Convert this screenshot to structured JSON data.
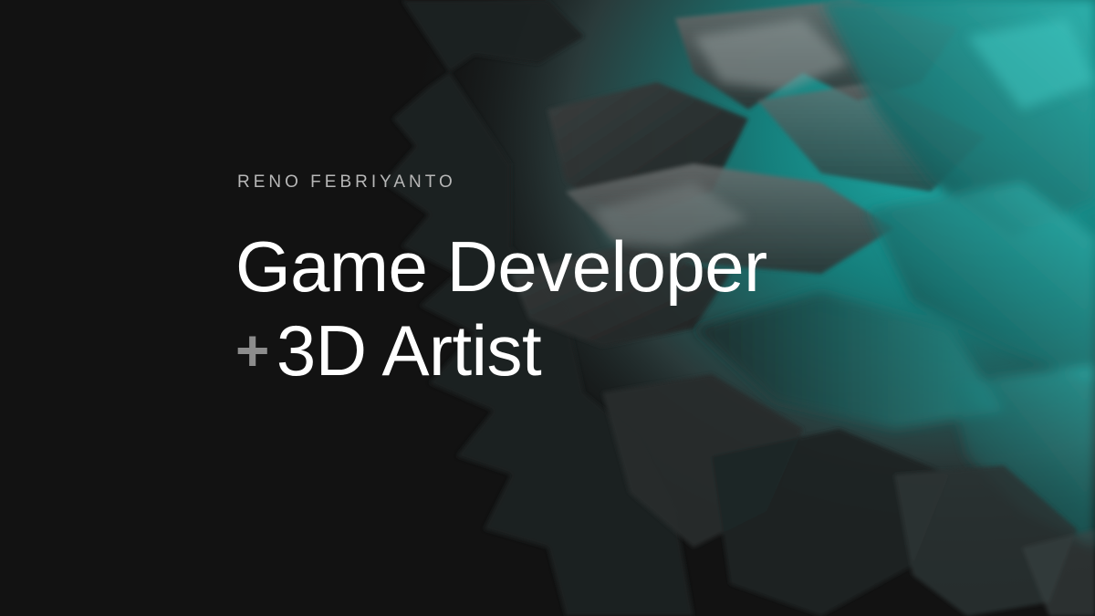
{
  "hero": {
    "author_name": "RENO FEBRIYANTO",
    "title_line1": "Game Developer",
    "plus_symbol": "+",
    "title_line2": "3D Artist"
  },
  "colors": {
    "background": "#121212",
    "accent_teal": "#19a3a1",
    "text_primary": "#ffffff",
    "text_secondary": "#b7b7b7",
    "plus_gray": "#8c8c8c"
  },
  "icons": {
    "background_art": "abstract-teal-crystal-shape"
  }
}
